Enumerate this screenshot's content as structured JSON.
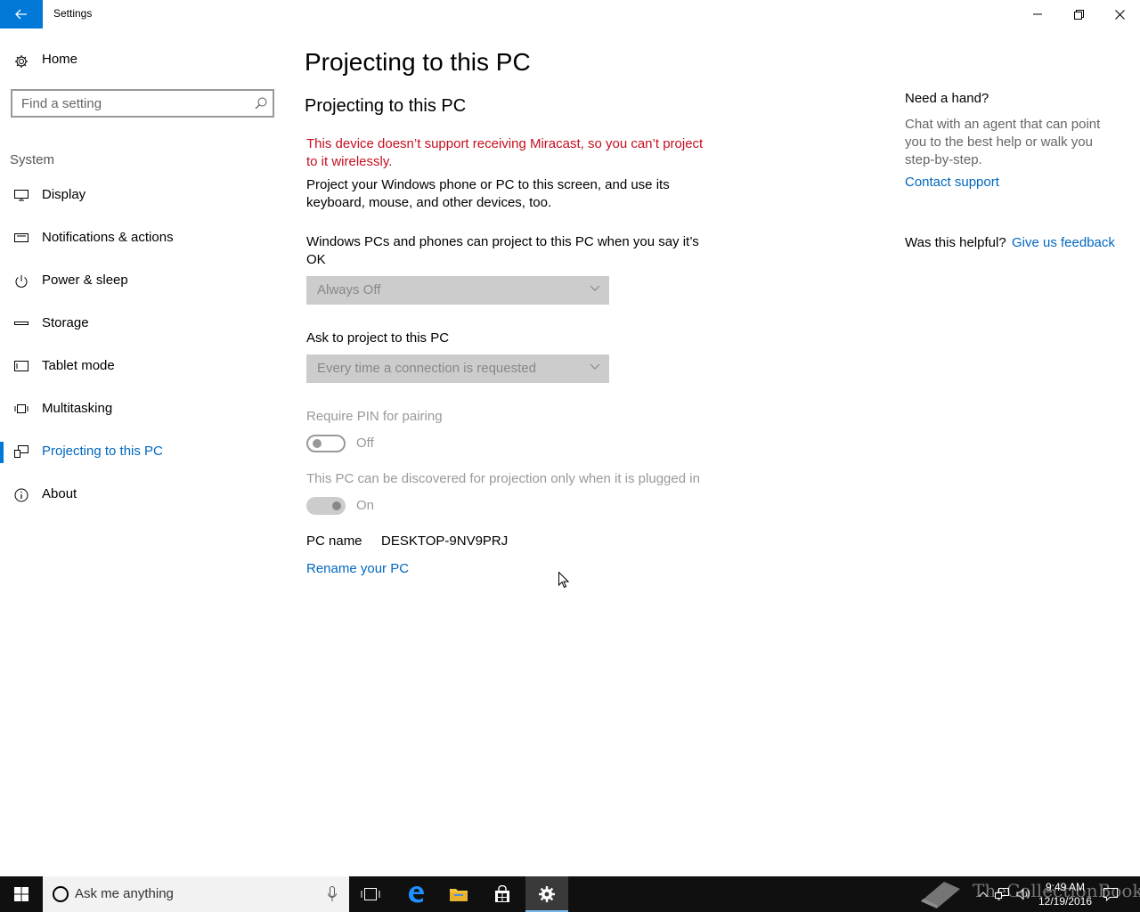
{
  "window": {
    "title": "Settings"
  },
  "sidebar": {
    "home_label": "Home",
    "search_placeholder": "Find a setting",
    "section_label": "System",
    "items": [
      {
        "label": "Display",
        "icon": "monitor-icon",
        "active": false
      },
      {
        "label": "Notifications & actions",
        "icon": "notification-icon",
        "active": false
      },
      {
        "label": "Power & sleep",
        "icon": "power-icon",
        "active": false
      },
      {
        "label": "Storage",
        "icon": "storage-icon",
        "active": false
      },
      {
        "label": "Tablet mode",
        "icon": "tablet-icon",
        "active": false
      },
      {
        "label": "Multitasking",
        "icon": "multitasking-icon",
        "active": false
      },
      {
        "label": "Projecting to this PC",
        "icon": "projecting-icon",
        "active": true
      },
      {
        "label": "About",
        "icon": "info-icon",
        "active": false
      }
    ]
  },
  "main": {
    "page_title": "Projecting to this PC",
    "section_title": "Projecting to this PC",
    "warning": "This device doesn’t support receiving Miracast, so you can’t project to it wirelessly.",
    "description": "Project your Windows phone or PC to this screen, and use its keyboard, mouse, and other devices, too.",
    "when_label": "Windows PCs and phones can project to this PC when you say it’s OK",
    "when_value": "Always Off",
    "ask_label": "Ask to project to this PC",
    "ask_value": "Every time a connection is requested",
    "pin_label": "Require PIN for pairing",
    "pin_state": "Off",
    "plugged_label": "This PC can be discovered for projection only when it is plugged in",
    "plugged_state": "On",
    "pcname_label": "PC name",
    "pcname_value": "DESKTOP-9NV9PRJ",
    "rename_link": "Rename your PC"
  },
  "help": {
    "title": "Need a hand?",
    "text": "Chat with an agent that can point you to the best help or walk you step-by-step.",
    "contact_link": "Contact support",
    "helpful_label": "Was this helpful?",
    "feedback_link": "Give us feedback"
  },
  "taskbar": {
    "search_text": "Ask me anything",
    "time": "9:49 AM",
    "date": "12/19/2016",
    "watermark": "TheCollectionBook"
  },
  "colors": {
    "accent": "#0078d7",
    "link": "#0067c0",
    "warning": "#c50f1f",
    "taskbar": "#101010"
  }
}
